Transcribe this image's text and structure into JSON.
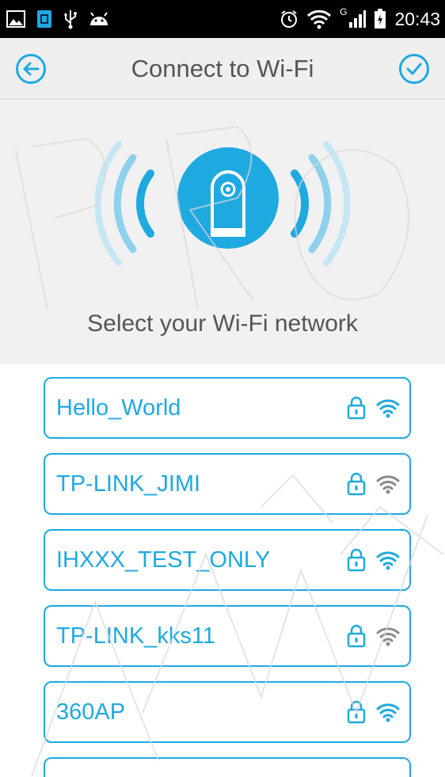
{
  "status_bar": {
    "time": "20:43",
    "network_label": "G",
    "icons": [
      "gallery-icon",
      "sim-icon",
      "usb-icon",
      "android-icon",
      "alarm-icon",
      "wifi-icon",
      "signal-icon",
      "battery-icon"
    ]
  },
  "header": {
    "title": "Connect to Wi-Fi",
    "back_icon": "arrow-left-circle-icon",
    "done_icon": "check-circle-icon",
    "accent": "#1fa9e1"
  },
  "hero": {
    "prompt": "Select your Wi-Fi network",
    "icon": "camera-broadcast-icon"
  },
  "networks": [
    {
      "ssid": "Hello_World",
      "locked": true,
      "signal": "strong"
    },
    {
      "ssid": "TP-LINK_JIMI",
      "locked": true,
      "signal": "weak"
    },
    {
      "ssid": "IHXXX_TEST_ONLY",
      "locked": true,
      "signal": "strong"
    },
    {
      "ssid": "TP-LINK_kks11",
      "locked": true,
      "signal": "medium"
    },
    {
      "ssid": "360AP",
      "locked": true,
      "signal": "strong"
    }
  ],
  "colors": {
    "accent": "#1fa9e1",
    "signal_strong": "#1fa9e1",
    "signal_weak": "#8a8a8a",
    "text_gray": "#555555"
  }
}
